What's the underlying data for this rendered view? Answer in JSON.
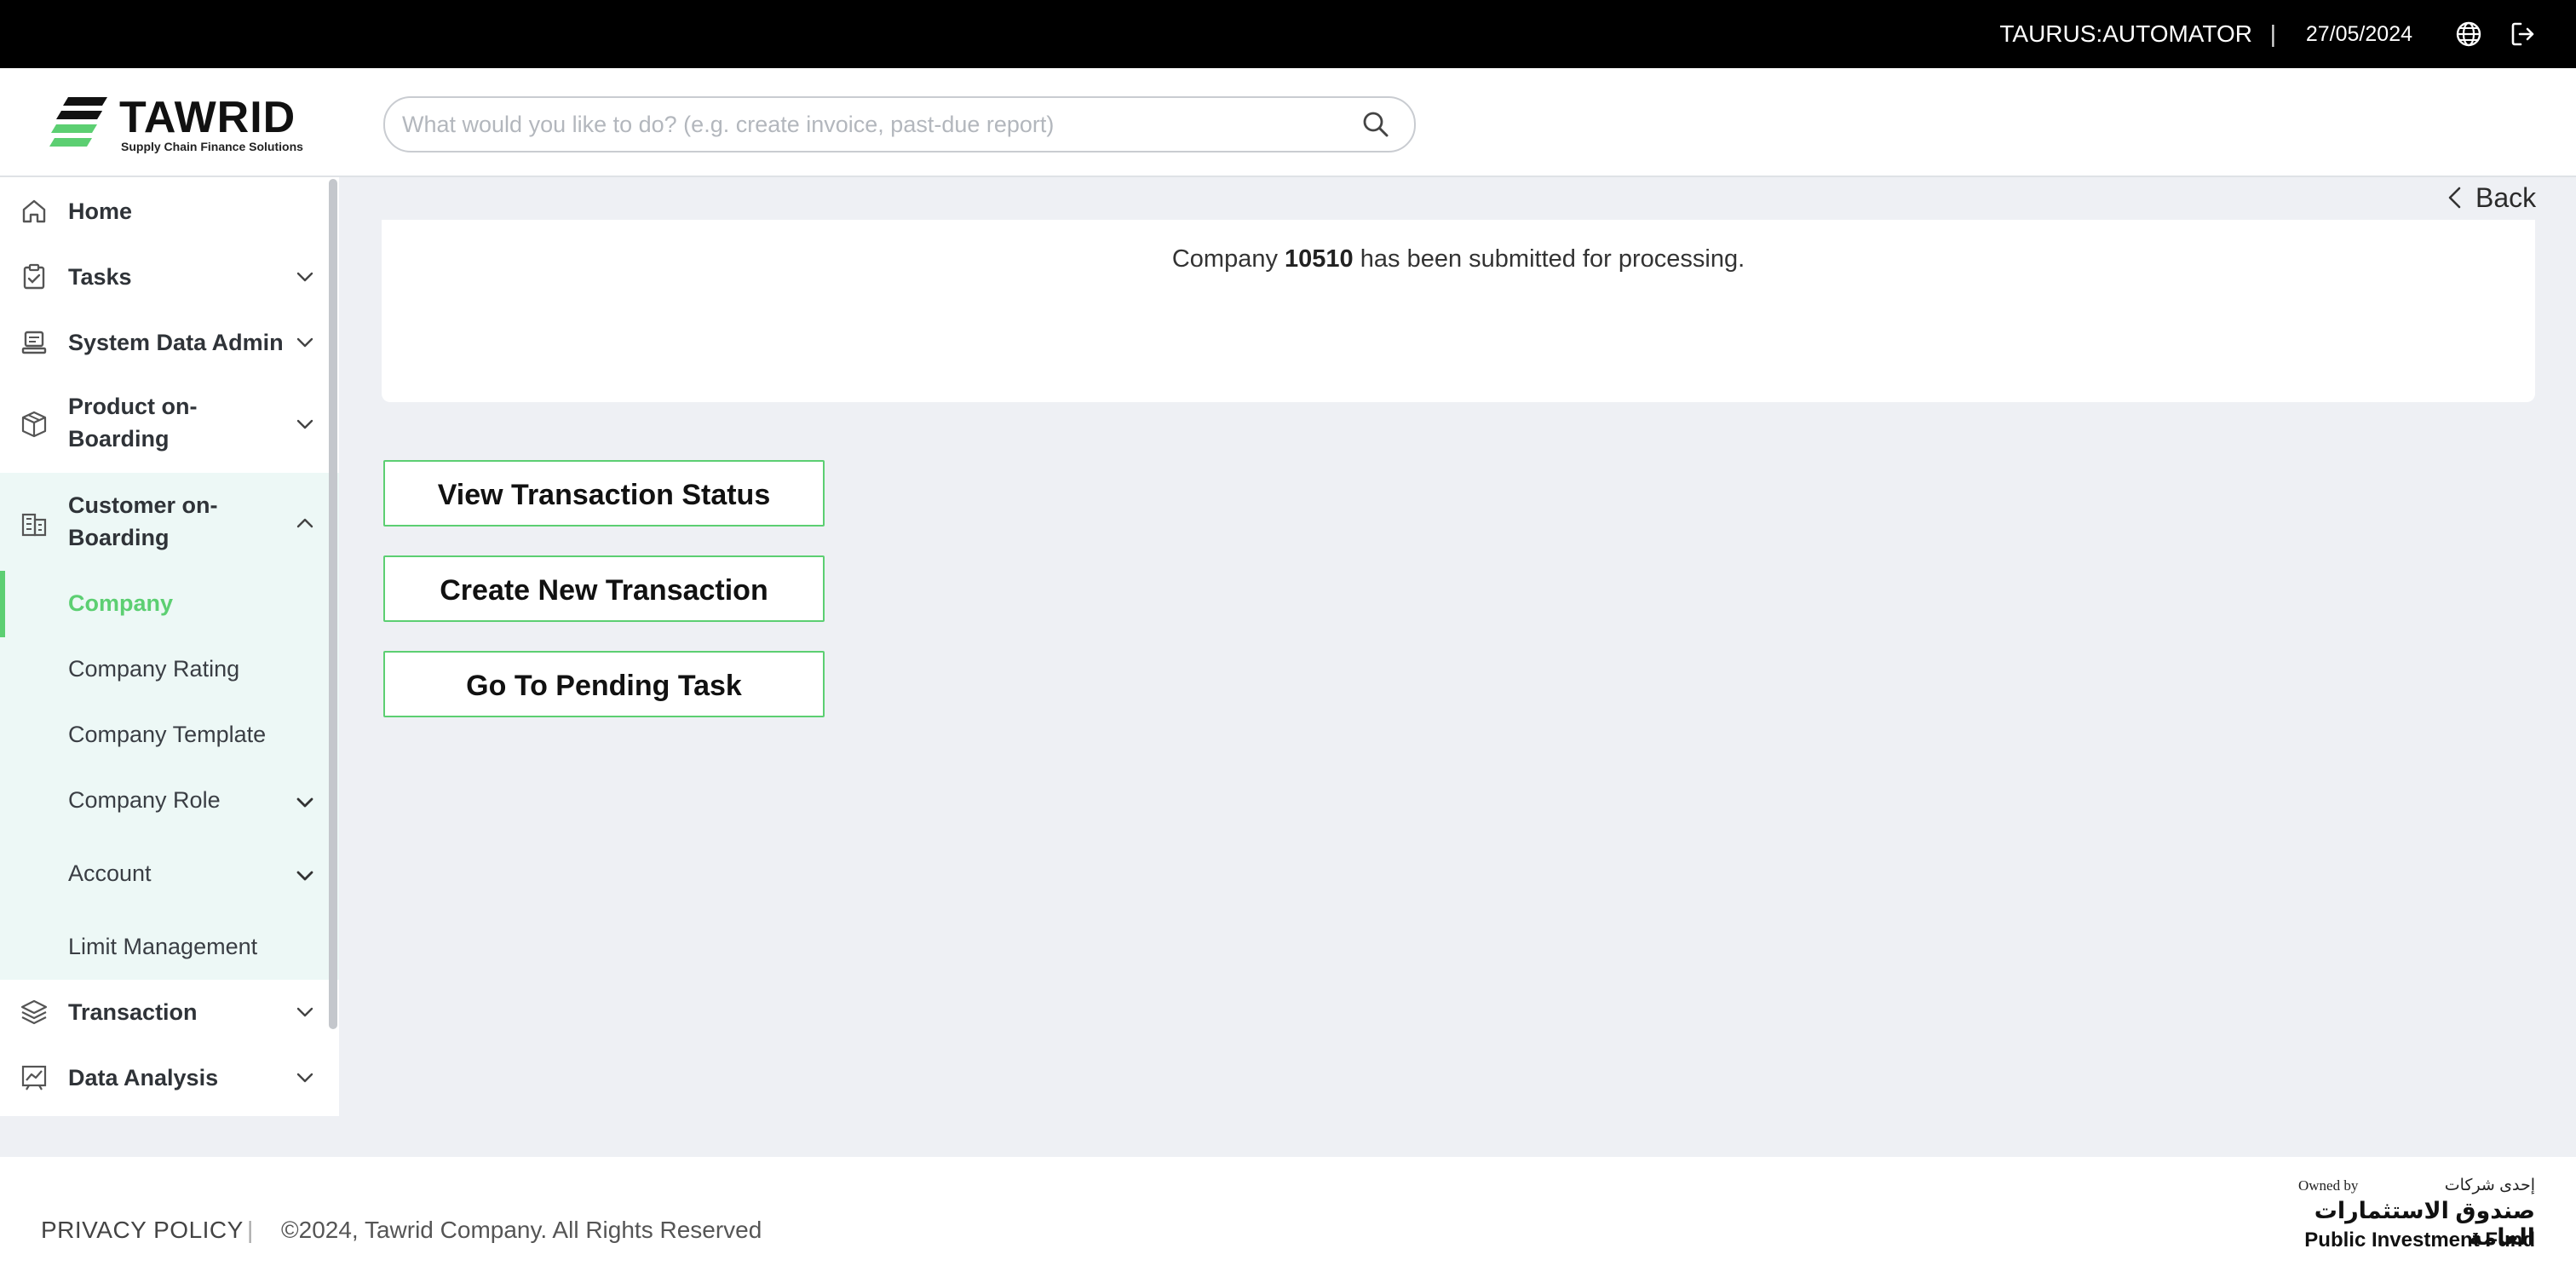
{
  "topbar": {
    "user": "TAURUS:AUTOMATOR",
    "separator": "|",
    "date": "27/05/2024",
    "icons": [
      "globe-icon",
      "logout-icon"
    ]
  },
  "header": {
    "logo_name": "TAWRID",
    "logo_tagline": "Supply Chain Finance Solutions",
    "search_placeholder": "What would you like to do? (e.g. create invoice, past-due report)"
  },
  "sidebar": {
    "items": [
      {
        "label": "Home",
        "icon": "home-icon"
      },
      {
        "label": "Tasks",
        "icon": "clipboard-check-icon"
      },
      {
        "label": "System Data Admin",
        "icon": "database-icon"
      },
      {
        "label": "Product on-Boarding",
        "icon": "box-icon"
      },
      {
        "label": "Customer on-Boarding",
        "icon": "building-icon"
      },
      {
        "label": "Transaction",
        "icon": "layers-icon"
      },
      {
        "label": "Data Analysis",
        "icon": "chart-icon"
      }
    ],
    "customer_sub": [
      {
        "label": "Company",
        "active": true
      },
      {
        "label": "Company Rating"
      },
      {
        "label": "Company Template"
      },
      {
        "label": "Company Role"
      },
      {
        "label": "Account"
      },
      {
        "label": "Limit Management"
      }
    ]
  },
  "main": {
    "back_label": "Back",
    "message_prefix": "Company",
    "company_id": "10510",
    "message_suffix": "has been submitted for processing.",
    "buttons": {
      "view_status": "View Transaction Status",
      "create_new": "Create New Transaction",
      "pending_task": "Go To Pending Task"
    }
  },
  "footer": {
    "privacy": "PRIVACY POLICY",
    "separator": "|",
    "copyright": "©2024, Tawrid Company. All Rights Reserved",
    "pif_owned": "Owned by",
    "pif_arabic_small": "إحدى شركات",
    "pif_arabic": "صندوق الاستثمارات العامة",
    "pif_english": "Public Investment Fund"
  },
  "colors": {
    "accent": "#5ccf72",
    "topbar": "#000000",
    "background": "#eef0f4",
    "submenu_bg": "#edf8f6"
  }
}
